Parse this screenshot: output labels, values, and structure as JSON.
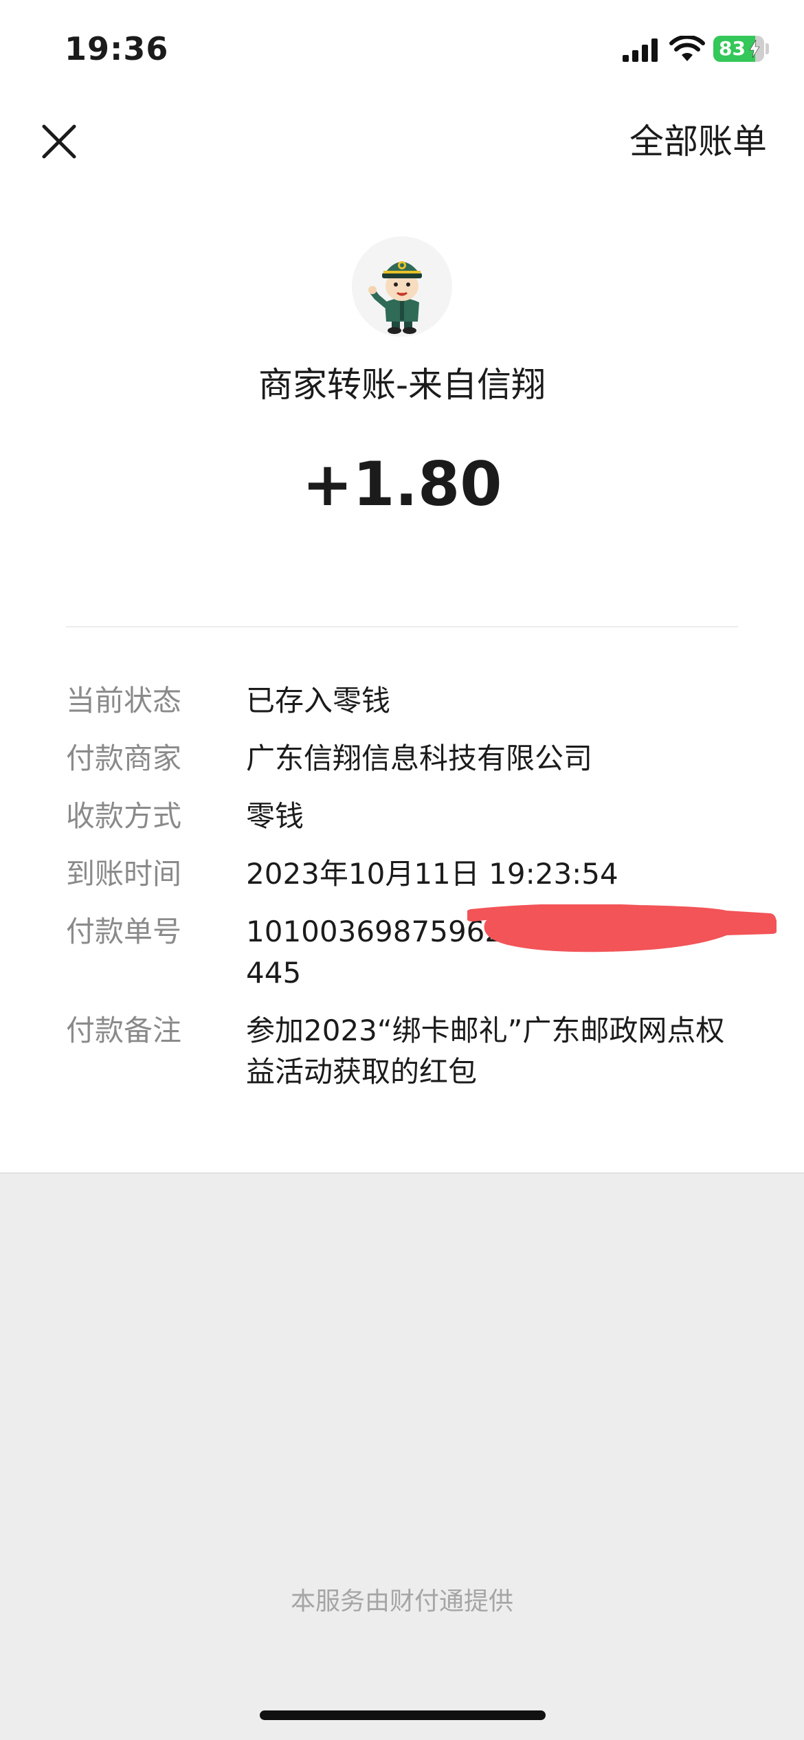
{
  "status_bar": {
    "time": "19:36",
    "battery_level": "83",
    "battery_fraction": 0.83,
    "signal_icon": "cellular-signal-icon",
    "wifi_icon": "wifi-icon",
    "battery_color": "#34c759"
  },
  "nav": {
    "close_icon": "close-icon",
    "all_bills_label": "全部账单"
  },
  "merchant": {
    "avatar": "mail-carrier-avatar",
    "title": "商家转账-来自信翔"
  },
  "amount": "+1.80",
  "details": [
    {
      "label": "当前状态",
      "value": "已存入零钱"
    },
    {
      "label": "付款商家",
      "value": "广东信翔信息科技有限公司"
    },
    {
      "label": "收款方式",
      "value": "零钱"
    },
    {
      "label": "到账时间",
      "value": "2023年10月11日 19:23:54"
    },
    {
      "label": "付款单号",
      "value": "10100369875962",
      "value_line2": "445",
      "redacted": true
    },
    {
      "label": "付款备注",
      "value": "参加2023“绑卡邮礼”广东邮政网点权益活动获取的红包"
    }
  ],
  "footer": {
    "note": "本服务由财付通提供"
  },
  "colors": {
    "label_gray": "#8a8a8a",
    "redaction_red": "#f25457",
    "background_gray": "#ededed"
  }
}
